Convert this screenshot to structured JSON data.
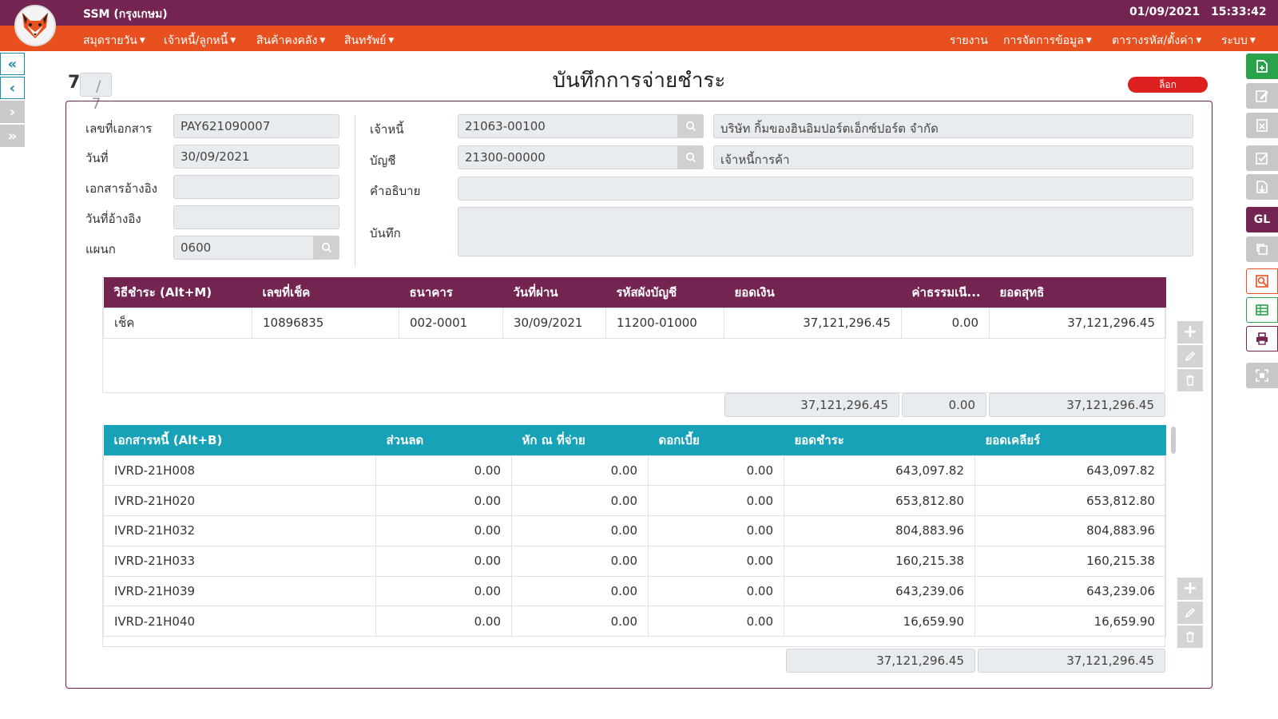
{
  "header": {
    "app_title": "SSM (กรุงเกษม)",
    "date": "01/09/2021",
    "time": "15:33:42"
  },
  "menu": {
    "left": [
      "สมุดรายวัน",
      "เจ้าหนี้/ลูกหนี้",
      "สินค้าคงคลัง",
      "สินทรัพย์"
    ],
    "right": [
      "รายงาน",
      "การจัดการข้อมูล",
      "ตารางรหัส/ตั้งค่า",
      "ระบบ"
    ]
  },
  "colors": {
    "header": "#742450",
    "menu": "#e8501f",
    "accent_teal": "#17a2b8",
    "lock": "#dc1f1f",
    "save_green": "#2aa24b"
  },
  "record": {
    "current": "7",
    "total": "/ 7"
  },
  "page": {
    "title": "บันทึกการจ่ายชำระ",
    "lock_label": "ล็อก"
  },
  "form": {
    "doc_no_label": "เลขที่เอกสาร",
    "doc_no": "PAY621090007",
    "date_label": "วันที่",
    "date": "30/09/2021",
    "ref_doc_label": "เอกสารอ้างอิง",
    "ref_doc": "",
    "ref_date_label": "วันที่อ้างอิง",
    "ref_date": "",
    "dept_label": "แผนก",
    "dept": "0600",
    "creditor_label": "เจ้าหนี้",
    "creditor_code": "21063-00100",
    "creditor_name": "บริษัท กิ้มของฮินอิมปอร์ตเอ็กซ์ปอร์ต จำกัด",
    "account_label": "บัญชี",
    "account_code": "21300-00000",
    "account_name": "เจ้าหนี้การค้า",
    "desc_label": "คำอธิบาย",
    "desc": "",
    "note_label": "บันทึก",
    "note": ""
  },
  "payments": {
    "headers": [
      "วิธีชำระ (Alt+M)",
      "เลขที่เช็ค",
      "ธนาคาร",
      "วันที่ผ่าน",
      "รหัสผังบัญชี",
      "ยอดเงิน",
      "ค่าธรรมเนี...",
      "ยอดสุทธิ"
    ],
    "rows": [
      [
        "เช็ค",
        "10896835",
        "002-0001",
        "30/09/2021",
        "11200-01000",
        "37,121,296.45",
        "0.00",
        "37,121,296.45"
      ]
    ],
    "totals": {
      "amount": "37,121,296.45",
      "fee": "0.00",
      "net": "37,121,296.45"
    }
  },
  "documents": {
    "headers": [
      "เอกสารหนี้ (Alt+B)",
      "ส่วนลด",
      "หัก ณ ที่จ่าย",
      "ดอกเบี้ย",
      "ยอดชำระ",
      "ยอดเคลียร์"
    ],
    "rows": [
      [
        "IVRD-21H008",
        "0.00",
        "0.00",
        "0.00",
        "643,097.82",
        "643,097.82"
      ],
      [
        "IVRD-21H020",
        "0.00",
        "0.00",
        "0.00",
        "653,812.80",
        "653,812.80"
      ],
      [
        "IVRD-21H032",
        "0.00",
        "0.00",
        "0.00",
        "804,883.96",
        "804,883.96"
      ],
      [
        "IVRD-21H033",
        "0.00",
        "0.00",
        "0.00",
        "160,215.38",
        "160,215.38"
      ],
      [
        "IVRD-21H039",
        "0.00",
        "0.00",
        "0.00",
        "643,239.06",
        "643,239.06"
      ],
      [
        "IVRD-21H040",
        "0.00",
        "0.00",
        "0.00",
        "16,659.90",
        "16,659.90"
      ]
    ],
    "totals": {
      "paid": "37,121,296.45",
      "cleared": "37,121,296.45"
    }
  }
}
